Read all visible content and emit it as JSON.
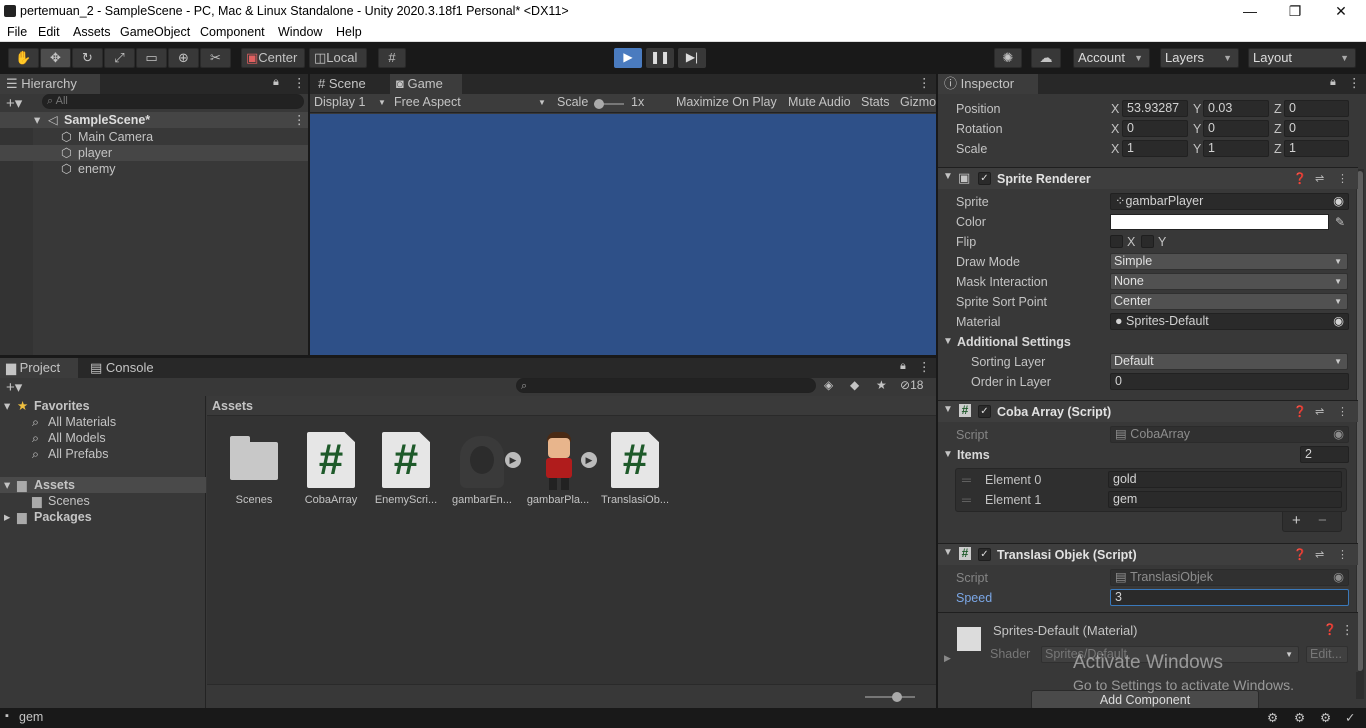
{
  "window": {
    "title": "pertemuan_2 - SampleScene - PC, Mac & Linux Standalone - Unity 2020.3.18f1 Personal* <DX11>",
    "minimize": "—",
    "restore": "❐",
    "close": "✕"
  },
  "menu": [
    "File",
    "Edit",
    "Assets",
    "GameObject",
    "Component",
    "Window",
    "Help"
  ],
  "toolbar": {
    "pivot": "Center",
    "space": "Local",
    "account": "Account",
    "layers": "Layers",
    "layout": "Layout"
  },
  "hierarchy": {
    "tab": "Hierarchy",
    "search_placeholder": "All",
    "scene": "SampleScene*",
    "objects": [
      "Main Camera",
      "player",
      "enemy"
    ],
    "selected": "player"
  },
  "scene_tabs": {
    "scene": "Scene",
    "game": "Game"
  },
  "game_bar": {
    "display": "Display 1",
    "aspect": "Free Aspect",
    "scale_label": "Scale",
    "scale_value": "1x",
    "maximize": "Maximize On Play",
    "mute": "Mute Audio",
    "stats": "Stats",
    "gizmos": "Gizmo"
  },
  "game_view_color": "#2e5088",
  "project": {
    "tab_project": "Project",
    "tab_console": "Console",
    "hidden_count": "18",
    "favorites": "Favorites",
    "fav_items": [
      "All Materials",
      "All Models",
      "All Prefabs"
    ],
    "assets": "Assets",
    "scenes": "Scenes",
    "packages": "Packages",
    "breadcrumb": "Assets",
    "items": [
      "Scenes",
      "CobaArray",
      "EnemyScri...",
      "gambarEn...",
      "gambarPla...",
      "TranslasiOb..."
    ]
  },
  "inspector": {
    "tab": "Inspector",
    "transform": {
      "position": {
        "label": "Position",
        "x": "53.93287",
        "y": "0.03",
        "z": "0"
      },
      "rotation": {
        "label": "Rotation",
        "x": "0",
        "y": "0",
        "z": "0"
      },
      "scale": {
        "label": "Scale",
        "x": "1",
        "y": "1",
        "z": "1"
      }
    },
    "sprite_renderer": {
      "title": "Sprite Renderer",
      "sprite_label": "Sprite",
      "sprite": "gambarPlayer",
      "color_label": "Color",
      "flip_label": "Flip",
      "flip_x": "X",
      "flip_y": "Y",
      "draw_mode_label": "Draw Mode",
      "draw_mode": "Simple",
      "mask_label": "Mask Interaction",
      "mask": "None",
      "sort_label": "Sprite Sort Point",
      "sort": "Center",
      "material_label": "Material",
      "material": "Sprites-Default",
      "additional": "Additional Settings",
      "sorting_layer_label": "Sorting Layer",
      "sorting_layer": "Default",
      "order_label": "Order in Layer",
      "order": "0"
    },
    "coba_array": {
      "title": "Coba Array (Script)",
      "script_label": "Script",
      "script": "CobaArray",
      "items_label": "Items",
      "items_count": "2",
      "elements": [
        {
          "label": "Element 0",
          "value": "gold"
        },
        {
          "label": "Element 1",
          "value": "gem"
        }
      ]
    },
    "translasi": {
      "title": "Translasi Objek (Script)",
      "script_label": "Script",
      "script": "TranslasiObjek",
      "speed_label": "Speed",
      "speed": "3"
    },
    "material": {
      "title": "Sprites-Default (Material)",
      "shader_label": "Shader",
      "shader": "Sprites/Default",
      "edit": "Edit..."
    },
    "add_component": "Add Component"
  },
  "watermark": {
    "line1": "Activate Windows",
    "line2": "Go to Settings to activate Windows."
  },
  "status": {
    "text": "gem"
  }
}
